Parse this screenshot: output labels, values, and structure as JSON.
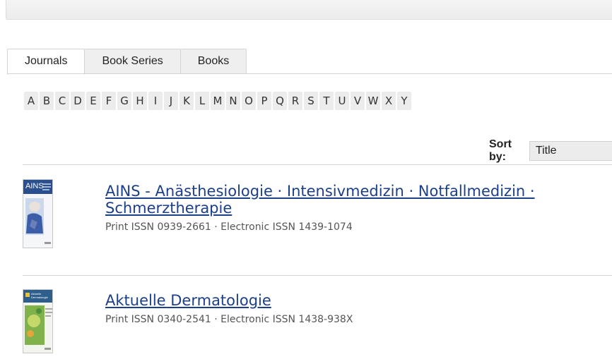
{
  "tabs": [
    {
      "label": "Journals",
      "active": true
    },
    {
      "label": "Book Series",
      "active": false
    },
    {
      "label": "Books",
      "active": false
    }
  ],
  "alphabet": [
    "A",
    "B",
    "C",
    "D",
    "E",
    "F",
    "G",
    "H",
    "I",
    "J",
    "K",
    "L",
    "M",
    "N",
    "O",
    "P",
    "Q",
    "R",
    "S",
    "T",
    "U",
    "V",
    "W",
    "X",
    "Y"
  ],
  "sort": {
    "label": "Sort by:",
    "value": "Title"
  },
  "journals": [
    {
      "title_line1": "AINS - Anästhesiologie · Intensivmedizin · Notfallmedizin ·",
      "title_line2": "Schmerztherapie",
      "issn": "Print ISSN 0939-2661 · Electronic ISSN 1439-1074",
      "cover_text": "AINS"
    },
    {
      "title_line1": "Aktuelle Dermatologie",
      "issn": "Print ISSN 0340-2541 · Electronic ISSN 1438-938X",
      "cover_text": "Aktuelle Dermatologie"
    }
  ],
  "colors": {
    "link": "#1b3f8b",
    "tab_bg": "#efefef",
    "letter_bg": "#ececec"
  }
}
